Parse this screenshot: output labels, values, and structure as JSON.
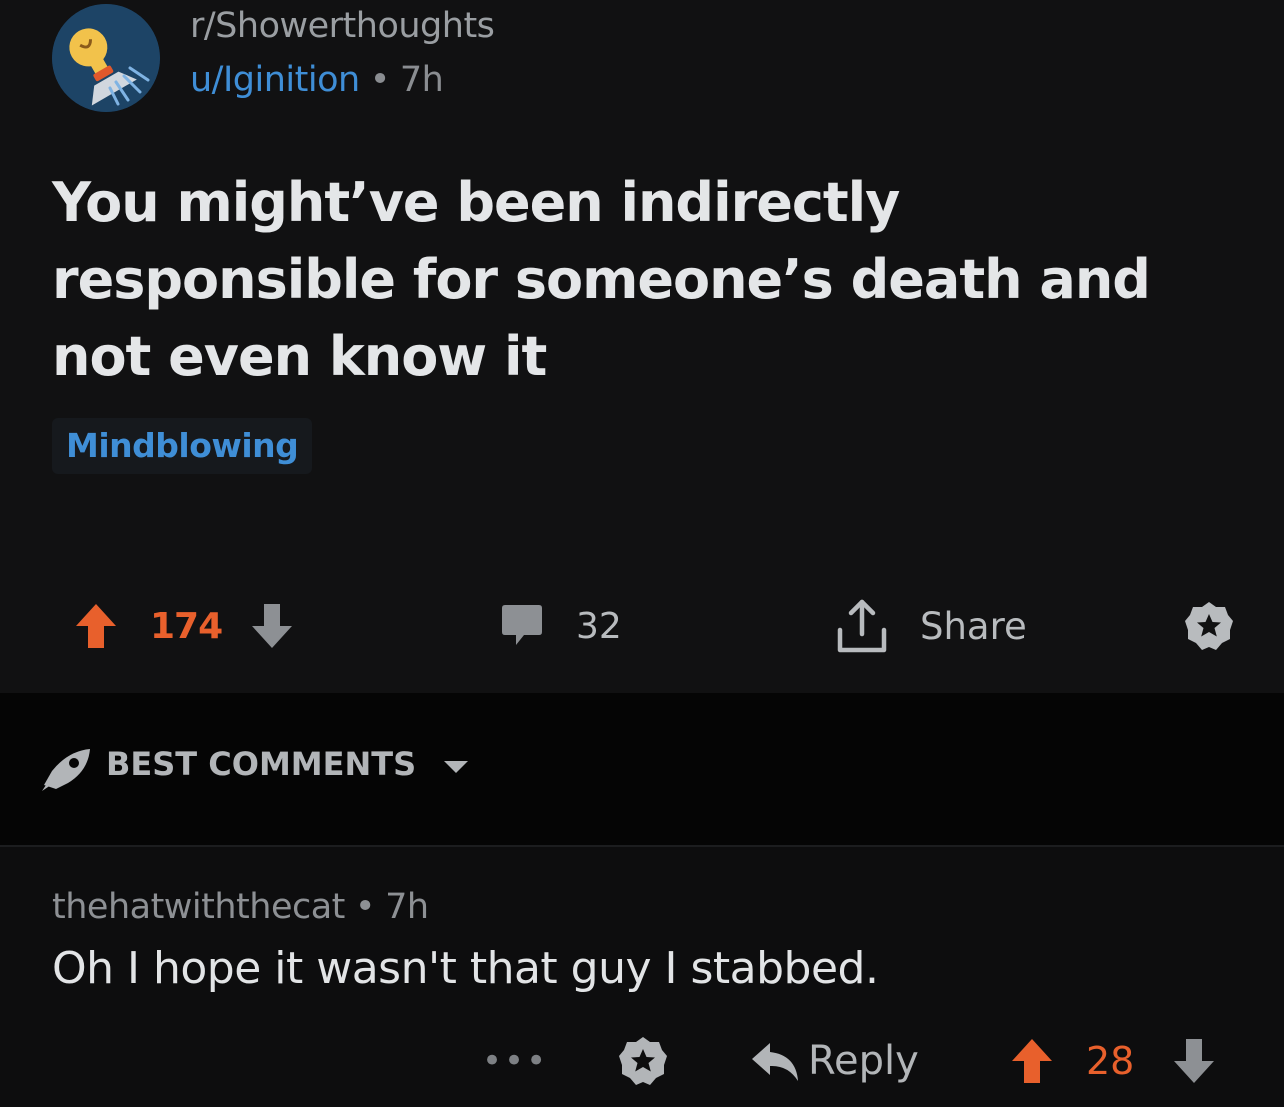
{
  "post": {
    "subreddit": "r/Showerthoughts",
    "author": "u/Iginition",
    "separator": "•",
    "age": "7h",
    "title": "You might’ve been indirectly responsible for someone’s death and not even know it",
    "flair": "Mindblowing",
    "score": "174",
    "comments_count": "32",
    "share_label": "Share"
  },
  "sort": {
    "label": "BEST COMMENTS"
  },
  "comment": {
    "author": "thehatwiththecat",
    "separator": "•",
    "age": "7h",
    "body": "Oh I hope it wasn't that guy I stabbed.",
    "more_label": "•••",
    "reply_label": "Reply",
    "score": "28"
  },
  "colors": {
    "background": "#0d0d0e",
    "post_background": "#111112",
    "upvote": "#e8602c",
    "link_blue": "#3f8ed6",
    "muted": "#8d9094"
  },
  "icons": {
    "avatar": "lightbulb-shower-icon",
    "upvote": "arrow-up-icon",
    "downvote": "arrow-down-icon",
    "comments": "speech-bubble-icon",
    "share": "share-upload-icon",
    "award": "star-badge-icon",
    "sort": "rocket-icon",
    "dropdown": "caret-down-icon",
    "reply": "reply-arrow-icon"
  }
}
